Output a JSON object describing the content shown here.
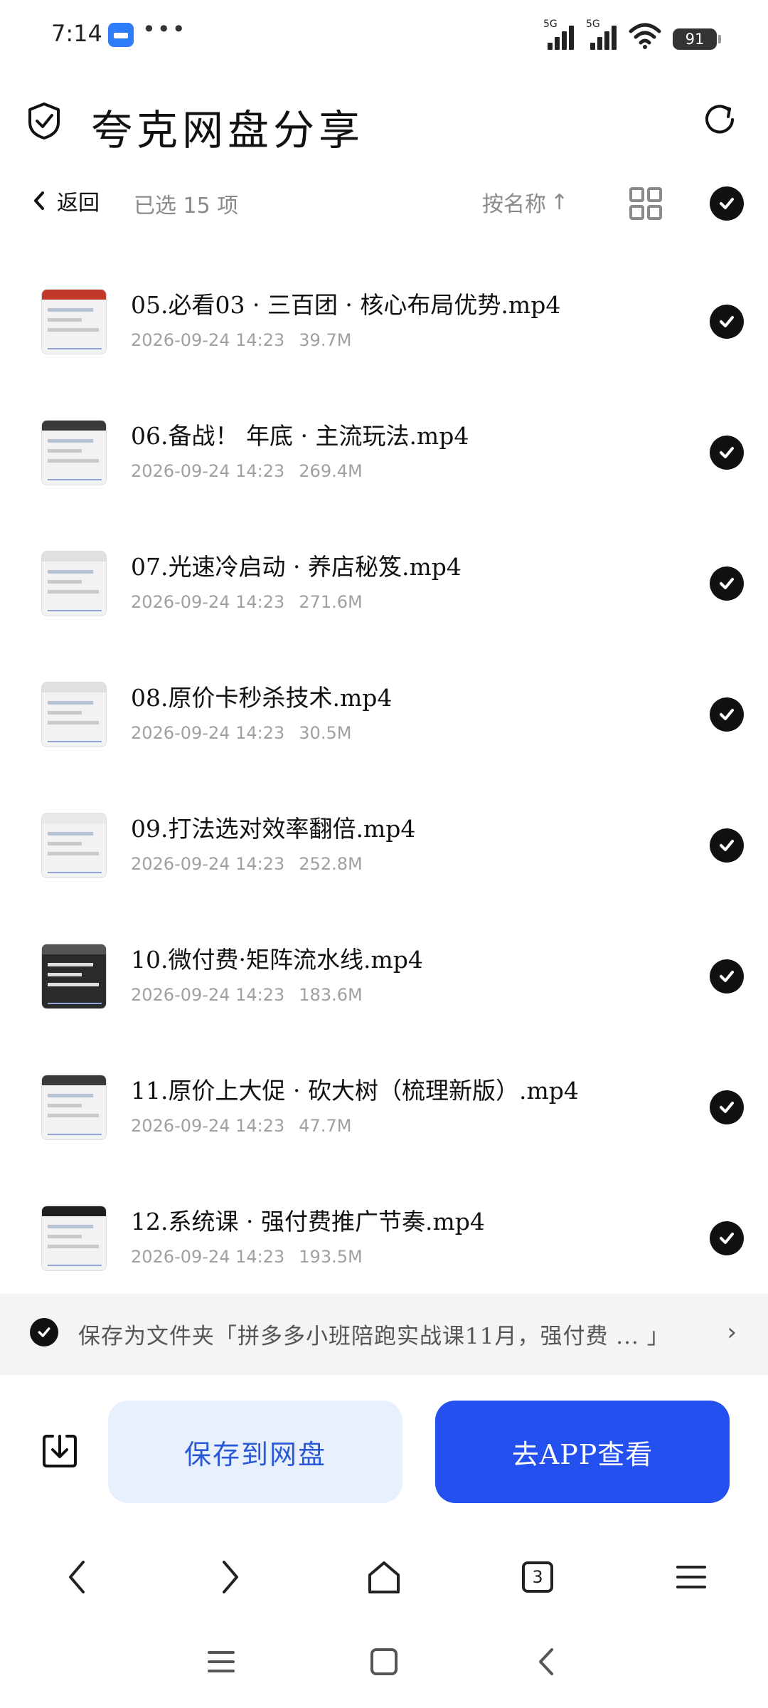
{
  "status_bar": {
    "time": "7:14",
    "more": "•••",
    "network_1": "5G",
    "network_2": "5G",
    "battery": "91"
  },
  "header": {
    "title": "夸克网盘分享"
  },
  "toolbar": {
    "back_label": "返回",
    "selected_label": "已选 15 项",
    "sort_label": "按名称",
    "sort_arrow": "↑"
  },
  "files": [
    {
      "name": "05.必看03 · 三百团 · 核心布局优势.mp4",
      "date": "2026-09-24 14:23",
      "size": "39.7M"
    },
    {
      "name": "06.备战！ 年底 · 主流玩法.mp4",
      "date": "2026-09-24 14:23",
      "size": "269.4M"
    },
    {
      "name": "07.光速冷启动 · 养店秘笈.mp4",
      "date": "2026-09-24 14:23",
      "size": "271.6M"
    },
    {
      "name": "08.原价卡秒杀技术.mp4",
      "date": "2026-09-24 14:23",
      "size": "30.5M"
    },
    {
      "name": "09.打法选对效率翻倍.mp4",
      "date": "2026-09-24 14:23",
      "size": "252.8M"
    },
    {
      "name": "10.微付费·矩阵流水线.mp4",
      "date": "2026-09-24 14:23",
      "size": "183.6M"
    },
    {
      "name": "11.原价上大促 · 砍大树（梳理新版）.mp4",
      "date": "2026-09-24 14:23",
      "size": "47.7M"
    },
    {
      "name": "12.系统课 · 强付费推广节奏.mp4",
      "date": "2026-09-24 14:23",
      "size": "193.5M"
    }
  ],
  "folder_bar": {
    "text": "保存为文件夹「拼多多小班陪跑实战课11月，强付费 ... 」",
    "chevron": "›"
  },
  "actions": {
    "save_label": "保存到网盘",
    "app_label": "去APP查看"
  },
  "browser_nav": {
    "tabs_count": "3"
  },
  "colors": {
    "primary_blue": "#2450f0",
    "light_blue": "#e8f0fd",
    "check_black": "#111111",
    "meta_gray": "#a0a0a0"
  }
}
